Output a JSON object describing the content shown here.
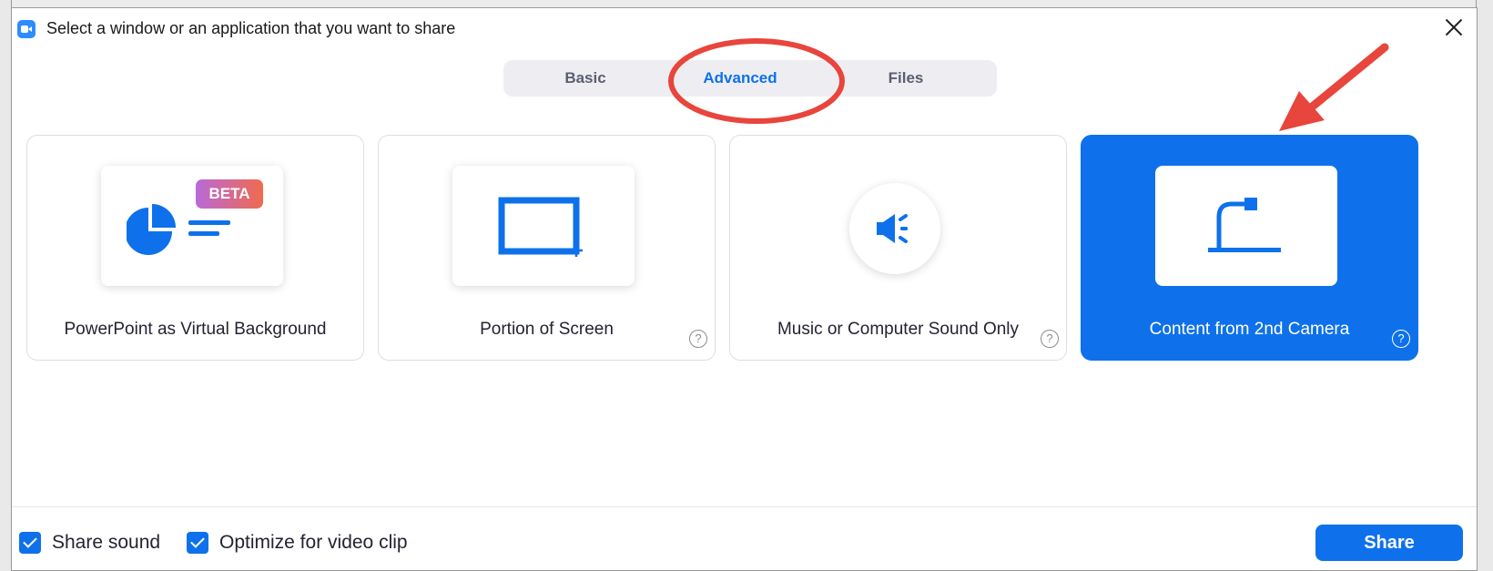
{
  "dialog": {
    "title": "Select a window or an application that you want to share"
  },
  "tabs": [
    {
      "label": "Basic"
    },
    {
      "label": "Advanced",
      "active": true
    },
    {
      "label": "Files"
    }
  ],
  "cards": [
    {
      "label": "PowerPoint as Virtual Background",
      "badge": "BETA",
      "icon": "powerpoint-icon"
    },
    {
      "label": "Portion of Screen",
      "icon": "screen-portion-icon",
      "help": "?"
    },
    {
      "label": "Music or Computer Sound Only",
      "icon": "speaker-icon",
      "help": "?"
    },
    {
      "label": "Content from 2nd Camera",
      "icon": "document-camera-icon",
      "help": "?",
      "selected": true
    }
  ],
  "footer": {
    "share_sound": {
      "label": "Share sound",
      "checked": true
    },
    "optimize_video": {
      "label": "Optimize for video clip",
      "checked": true
    },
    "share_button": "Share"
  },
  "colors": {
    "accent": "#0e71eb",
    "annotation": "#e8453c"
  }
}
